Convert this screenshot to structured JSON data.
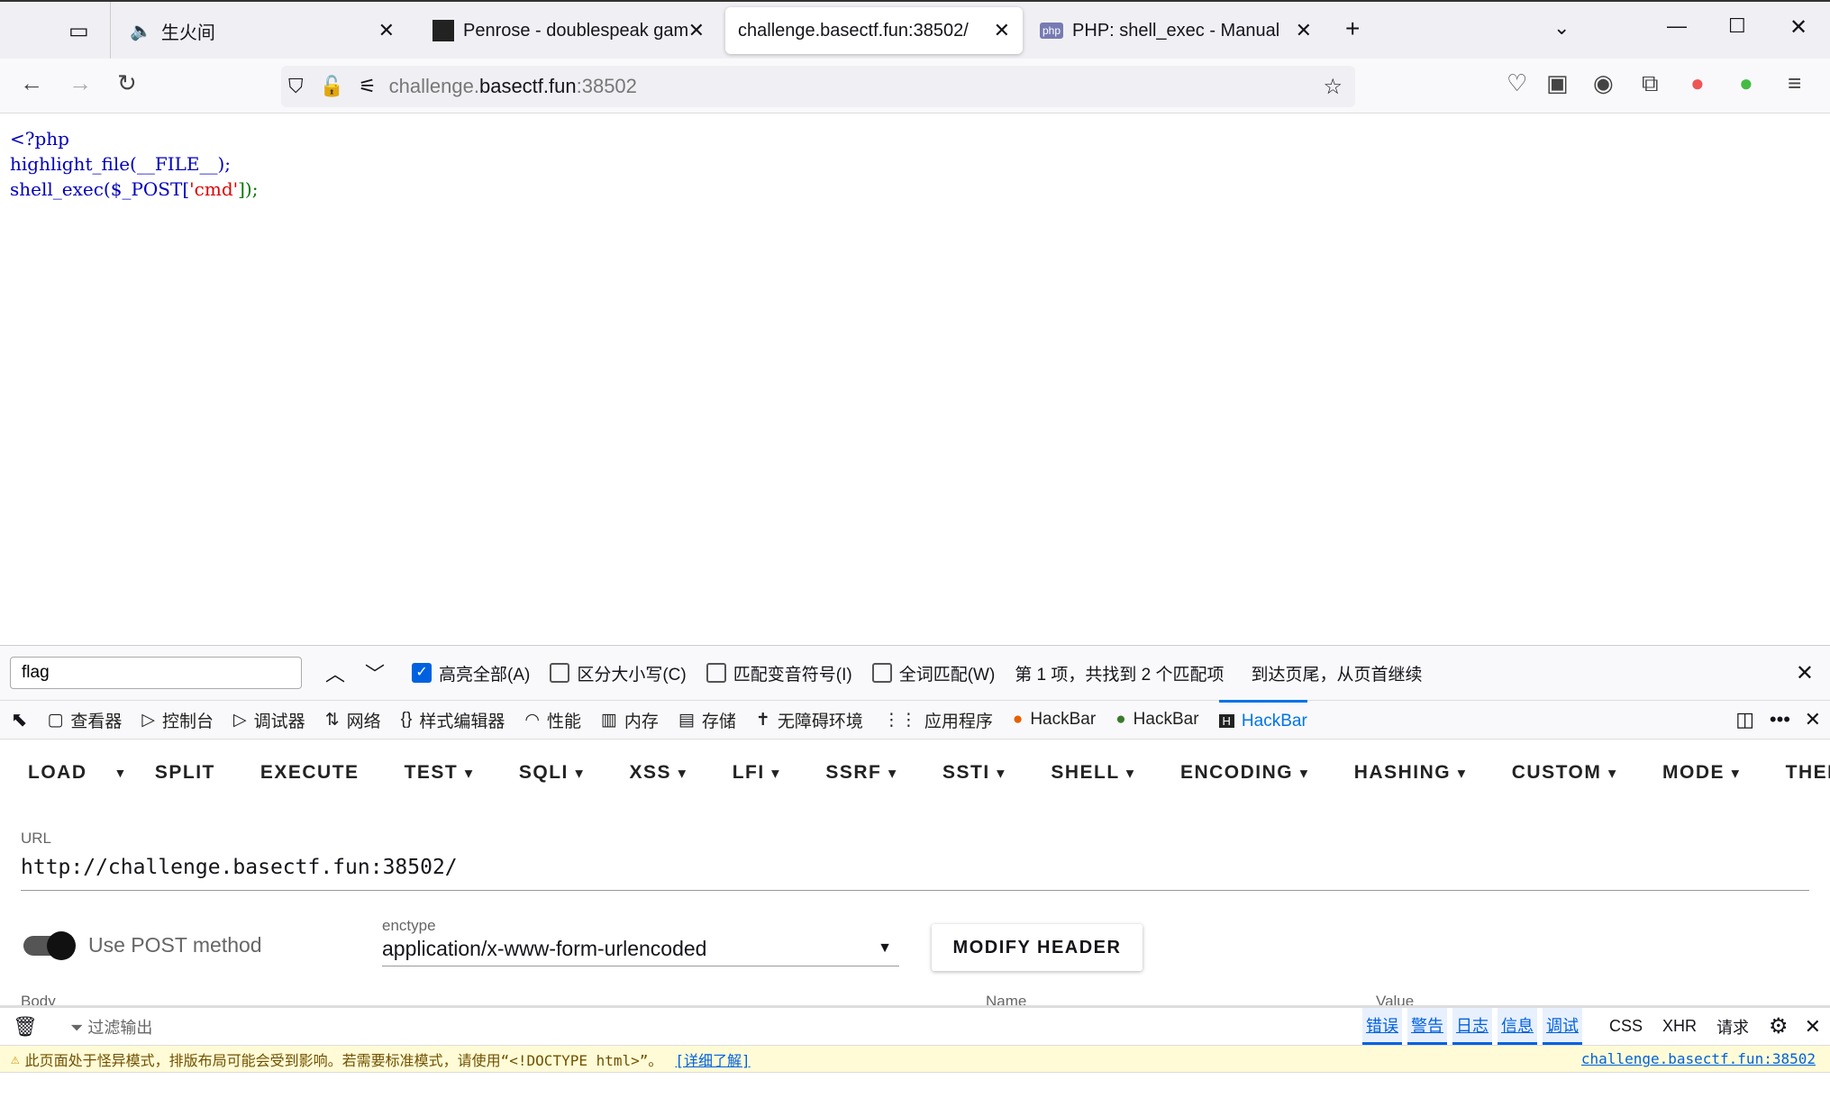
{
  "tabs": [
    {
      "label": "生火间",
      "audio": true
    },
    {
      "label": "Penrose - doublespeak game"
    },
    {
      "label": "challenge.basectf.fun:38502/",
      "active": true
    },
    {
      "label": "PHP: shell_exec - Manual"
    }
  ],
  "url": {
    "host_pre": "challenge.",
    "host": "basectf.fun",
    "port": ":38502"
  },
  "code": {
    "line1": "<?php",
    "line2_fn": "highlight_file(__FILE__);",
    "line3_a": "shell_exec($_POST[",
    "line3_str": "'cmd'",
    "line3_b": "]);"
  },
  "find": {
    "value": "flag",
    "options": [
      "高亮全部(A)",
      "区分大小写(C)",
      "匹配变音符号(I)",
      "全词匹配(W)"
    ],
    "result": "第 1 项，共找到 2 个匹配项",
    "wrap": "到达页尾，从页首继续"
  },
  "devtools": {
    "tabs": [
      "查看器",
      "控制台",
      "调试器",
      "网络",
      "样式编辑器",
      "性能",
      "内存",
      "存储",
      "无障碍环境",
      "应用程序",
      "HackBar",
      "HackBar",
      "HackBar"
    ]
  },
  "hackbar": {
    "menu": [
      "LOAD",
      "SPLIT",
      "EXECUTE",
      "TEST",
      "SQLI",
      "XSS",
      "LFI",
      "SSRF",
      "SSTI",
      "SHELL",
      "ENCODING",
      "HASHING",
      "CUSTOM",
      "MODE",
      "THEM"
    ],
    "url_label": "URL",
    "url_value": "http://challenge.basectf.fun:38502/",
    "post_label": "Use POST method",
    "enctype_label": "enctype",
    "enctype_value": "application/x-www-form-urlencoded",
    "modify_header": "MODIFY HEADER",
    "body_label": "Body",
    "name_label": "Name",
    "value_label": "Value"
  },
  "console": {
    "filter": "过滤输出",
    "levels": [
      "错误",
      "警告",
      "日志",
      "信息",
      "调试"
    ],
    "extra": [
      "CSS",
      "XHR",
      "请求"
    ],
    "warning": "此页面处于怪异模式，排版布局可能会受到影响。若需要标准模式，请使用“<!DOCTYPE html>”。",
    "learn_more": "[详细了解]",
    "source": "challenge.basectf.fun:38502"
  }
}
